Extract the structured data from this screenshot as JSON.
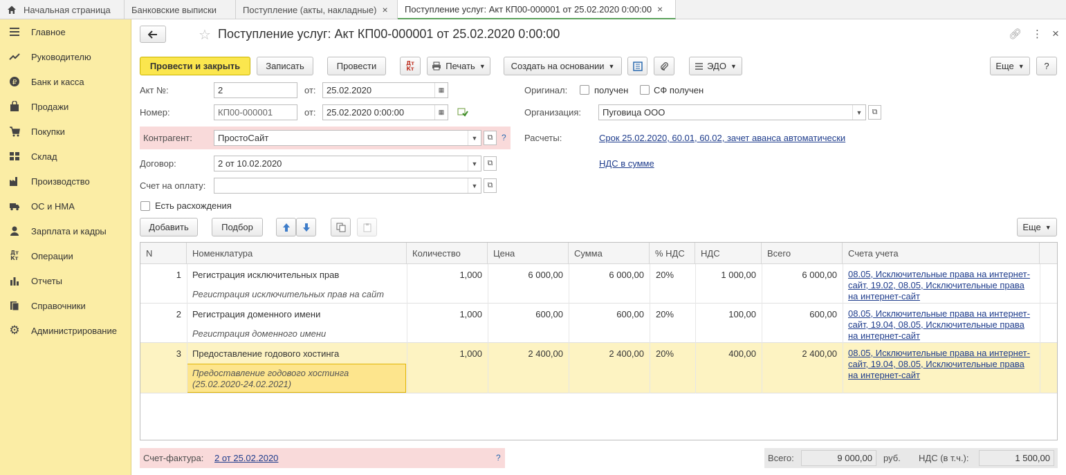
{
  "tabs": [
    {
      "label": "Начальная страница"
    },
    {
      "label": "Банковские выписки"
    },
    {
      "label": "Поступление (акты, накладные)"
    },
    {
      "label": "Поступление услуг: Акт КП00-000001 от 25.02.2020 0:00:00"
    }
  ],
  "sidebar": {
    "items": [
      {
        "label": "Главное",
        "icon": "menu-icon"
      },
      {
        "label": "Руководителю",
        "icon": "chart-trend-icon"
      },
      {
        "label": "Банк и касса",
        "icon": "ruble-icon"
      },
      {
        "label": "Продажи",
        "icon": "bag-icon"
      },
      {
        "label": "Покупки",
        "icon": "cart-icon"
      },
      {
        "label": "Склад",
        "icon": "warehouse-icon"
      },
      {
        "label": "Производство",
        "icon": "factory-icon"
      },
      {
        "label": "ОС и НМА",
        "icon": "truck-icon"
      },
      {
        "label": "Зарплата и кадры",
        "icon": "person-icon"
      },
      {
        "label": "Операции",
        "icon": "dt-kt-icon"
      },
      {
        "label": "Отчеты",
        "icon": "bar-chart-icon"
      },
      {
        "label": "Справочники",
        "icon": "books-icon"
      },
      {
        "label": "Администрирование",
        "icon": "gear-icon"
      }
    ]
  },
  "doc": {
    "title": "Поступление услуг: Акт КП00-000001 от 25.02.2020 0:00:00"
  },
  "toolbar": {
    "post_close": "Провести и закрыть",
    "save": "Записать",
    "post": "Провести",
    "dtkt": "Дт Кт",
    "print": "Печать",
    "create_based": "Создать на основании",
    "edo": "ЭДО",
    "more": "Еще",
    "help": "?"
  },
  "form": {
    "act_label": "Акт №:",
    "act_value": "2",
    "from_label": "от:",
    "act_date": "25.02.2020",
    "number_label": "Номер:",
    "number_value": "КП00-000001",
    "number_date": "25.02.2020  0:00:00",
    "counterparty_label": "Контрагент:",
    "counterparty_value": "ПростоСайт",
    "contract_label": "Договор:",
    "contract_value": "2 от 10.02.2020",
    "invoice_label": "Счет на оплату:",
    "invoice_value": "",
    "discrepancy_label": "Есть расхождения",
    "original_label": "Оригинал:",
    "received_label": "получен",
    "sf_received_label": "СФ получен",
    "org_label": "Организация:",
    "org_value": "Пуговица ООО",
    "settlements_label": "Расчеты:",
    "settlements_link": "Срок 25.02.2020, 60.01, 60.02, зачет аванса автоматически",
    "vat_link": "НДС в сумме"
  },
  "table_toolbar": {
    "add": "Добавить",
    "pick": "Подбор",
    "more": "Еще"
  },
  "table": {
    "headers": [
      "N",
      "Номенклатура",
      "Количество",
      "Цена",
      "Сумма",
      "% НДС",
      "НДС",
      "Всего",
      "Счета учета"
    ],
    "rows": [
      {
        "n": "1",
        "name": "Регистрация исключительных прав",
        "desc": "Регистрация исключительных прав на сайт",
        "qty": "1,000",
        "price": "6 000,00",
        "sum": "6 000,00",
        "vat_rate": "20%",
        "vat": "1 000,00",
        "total": "6 000,00",
        "accounts": "08.05, Исключительные права на интернет-сайт, 19.02, 08.05, Исключительные права на интернет-сайт"
      },
      {
        "n": "2",
        "name": "Регистрация доменного имени",
        "desc": "Регистрация доменного имени",
        "qty": "1,000",
        "price": "600,00",
        "sum": "600,00",
        "vat_rate": "20%",
        "vat": "100,00",
        "total": "600,00",
        "accounts": "08.05, Исключительные права на интернет-сайт, 19.04, 08.05, Исключительные права на интернет-сайт"
      },
      {
        "n": "3",
        "name": "Предоставление годового хостинга",
        "desc": "Предоставление годового хостинга (25.02.2020-24.02.2021)",
        "qty": "1,000",
        "price": "2 400,00",
        "sum": "2 400,00",
        "vat_rate": "20%",
        "vat": "400,00",
        "total": "2 400,00",
        "accounts": "08.05, Исключительные права на интернет-сайт, 19.04, 08.05, Исключительные права на интернет-сайт"
      }
    ]
  },
  "footer": {
    "invoice_label": "Счет-фактура:",
    "invoice_link": "2 от 25.02.2020",
    "help": "?",
    "total_label": "Всего:",
    "total_value": "9 000,00",
    "currency": "руб.",
    "vat_label": "НДС (в т.ч.):",
    "vat_value": "1 500,00"
  },
  "colors": {
    "sidebar_bg": "#fbeda5",
    "primary_button": "#fbe64e",
    "highlight_row": "#fdf3c2",
    "error_bg": "#f9dada",
    "link": "#1e3c8c"
  }
}
